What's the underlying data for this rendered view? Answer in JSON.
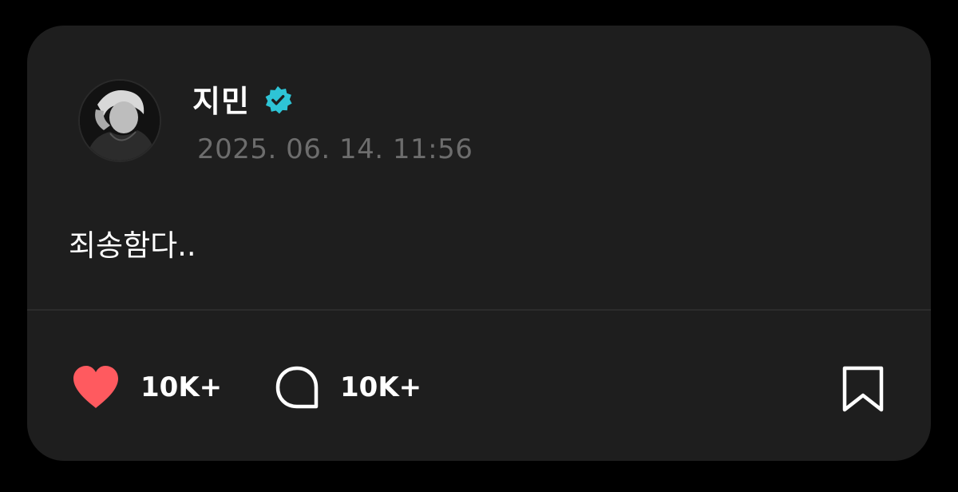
{
  "post": {
    "author": "지민",
    "verified": true,
    "timestamp": "2025. 06. 14. 11:56",
    "text": "죄송함다.."
  },
  "actions": {
    "like_count": "10K+",
    "comment_count": "10K+"
  },
  "icons": {
    "like": "heart-icon",
    "comment": "speech-bubble-icon",
    "bookmark": "bookmark-icon",
    "verified": "verified-badge-icon"
  },
  "colors": {
    "background": "#000000",
    "card": "#1e1e1e",
    "like": "#ff5a5f",
    "verified": "#2ec4d6",
    "timestamp": "#6d6d6d",
    "text": "#ffffff"
  }
}
